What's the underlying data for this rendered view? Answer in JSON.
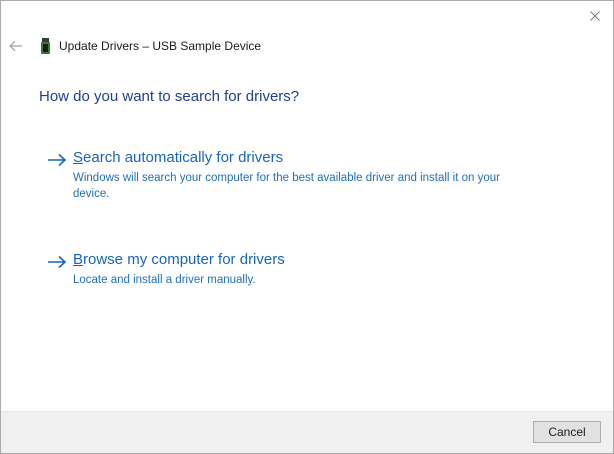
{
  "window": {
    "title": "Update Drivers – USB Sample Device",
    "close_icon": "close-icon",
    "back_icon": "back-arrow-icon",
    "device_icon": "usb-device-icon"
  },
  "heading": "How do you want to search for drivers?",
  "options": [
    {
      "accel": "S",
      "rest": "earch automatically for drivers",
      "description": "Windows will search your computer for the best available driver and install it on your device.",
      "icon": "arrow-right-icon"
    },
    {
      "accel": "B",
      "rest": "rowse my computer for drivers",
      "description": "Locate and install a driver manually.",
      "icon": "arrow-right-icon"
    }
  ],
  "footer": {
    "cancel_label": "Cancel"
  },
  "colors": {
    "heading": "#1e3f95",
    "link": "#1565c0",
    "footer_bg": "#f0f0f0"
  }
}
